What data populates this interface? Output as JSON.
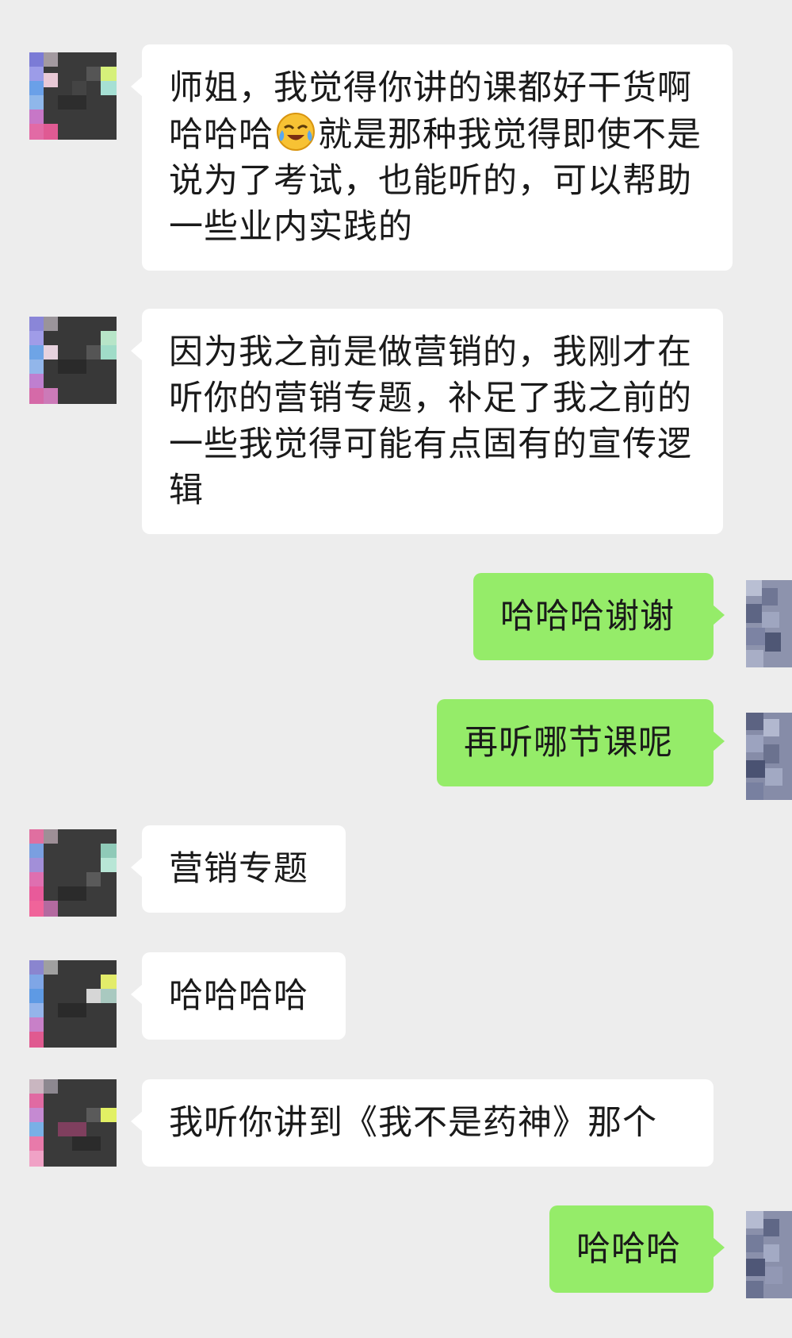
{
  "chat": {
    "messages": [
      {
        "side": "left",
        "text_before": "师姐，我觉得你讲的课都好干货啊哈哈哈",
        "emoji": "crying-laughing-icon",
        "text_after": "就是那种我觉得即使不是说为了考试，也能听的，可以帮助一些业内实践的"
      },
      {
        "side": "left",
        "text": "因为我之前是做营销的，我刚才在听你的营销专题，补足了我之前的一些我觉得可能有点固有的宣传逻辑"
      },
      {
        "side": "right",
        "text": "哈哈哈谢谢"
      },
      {
        "side": "right",
        "text": "再听哪节课呢"
      },
      {
        "side": "left",
        "text": "营销专题"
      },
      {
        "side": "left",
        "text": "哈哈哈哈"
      },
      {
        "side": "left",
        "text": "我听你讲到《我不是药神》那个"
      },
      {
        "side": "right",
        "text": "哈哈哈"
      }
    ]
  },
  "colors": {
    "background": "#ededed",
    "left_bubble": "#ffffff",
    "right_bubble": "#95ec69"
  },
  "avatars": {
    "left": "pixelated-mosaic-avatar",
    "right": "pixelated-blurred-avatar"
  }
}
